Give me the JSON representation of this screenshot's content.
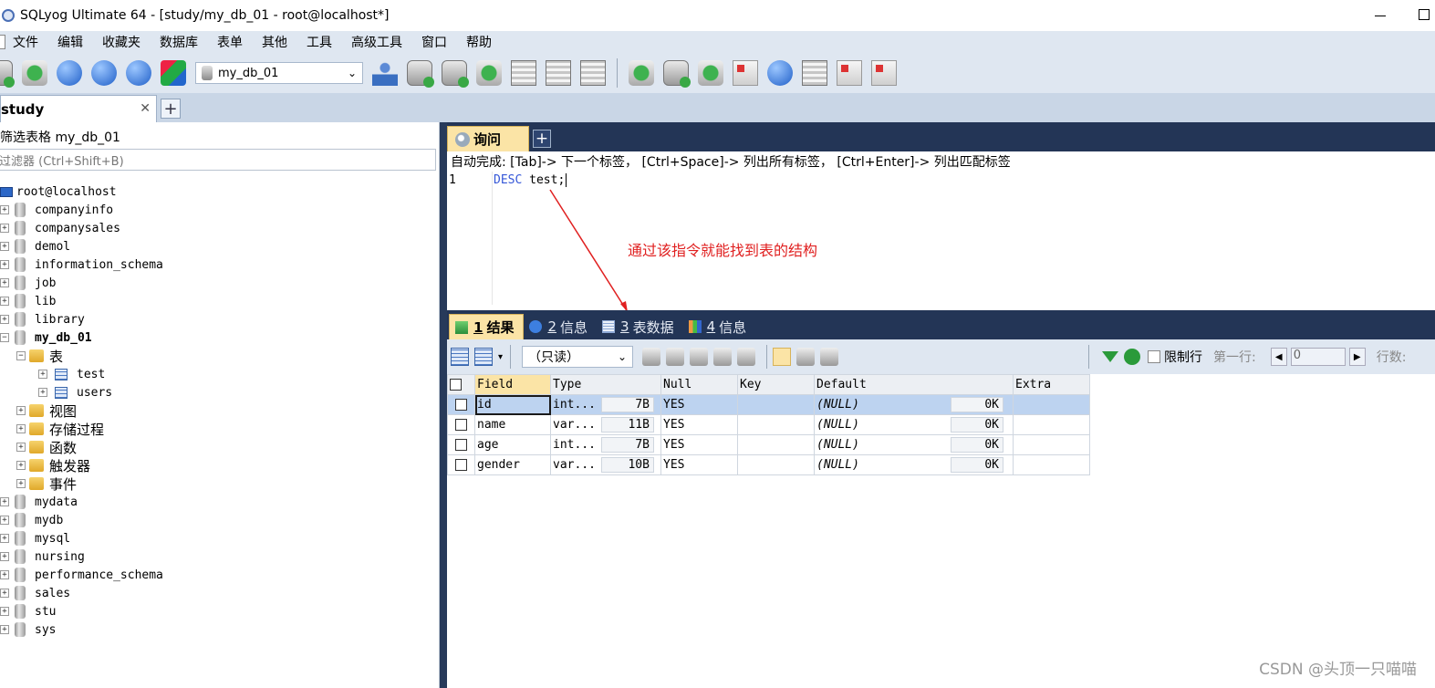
{
  "window": {
    "title": "SQLyog Ultimate 64 - [study/my_db_01 - root@localhost*]"
  },
  "menu": [
    "文件",
    "编辑",
    "收藏夹",
    "数据库",
    "表单",
    "其他",
    "工具",
    "高级工具",
    "窗口",
    "帮助"
  ],
  "toolbar": {
    "db_selector_value": "my_db_01"
  },
  "connection_tab": {
    "label": "study",
    "close_glyph": "✕",
    "add_glyph": "+"
  },
  "object_browser": {
    "filter_label": "筛选表格 my_db_01",
    "filter_placeholder": "过滤器 (Ctrl+Shift+B)",
    "server": "root@localhost",
    "databases_before": [
      "companyinfo",
      "companysales",
      "demol",
      "information_schema",
      "job",
      "lib",
      "library"
    ],
    "current_db": "my_db_01",
    "tables_folder": "表",
    "tables": [
      "test",
      "users"
    ],
    "other_folders": [
      "视图",
      "存储过程",
      "函数",
      "触发器",
      "事件"
    ],
    "databases_after": [
      "mydata",
      "mydb",
      "mysql",
      "nursing",
      "performance_schema",
      "sales",
      "stu",
      "sys"
    ]
  },
  "query": {
    "tab_label": "询问",
    "autocomplete_hint": "自动完成: [Tab]-> 下一个标签， [Ctrl+Space]-> 列出所有标签， [Ctrl+Enter]-> 列出匹配标签",
    "line_number": "1",
    "keyword": "DESC",
    "rest": " test;",
    "annotation": "通过该指令就能找到表的结构"
  },
  "result_tabs": [
    {
      "num": "1",
      "label": "结果"
    },
    {
      "num": "2",
      "label": "信息"
    },
    {
      "num": "3",
      "label": "表数据"
    },
    {
      "num": "4",
      "label": "信息"
    }
  ],
  "result_toolbar": {
    "mode": "（只读）",
    "limit_label": "限制行",
    "first_row_label": "第一行:",
    "first_row_value": "0",
    "rows_label": "行数:"
  },
  "grid": {
    "columns": [
      "Field",
      "Type",
      "Null",
      "Key",
      "Default",
      "Extra"
    ],
    "rows": [
      {
        "field": "id",
        "type": "int...",
        "type_size": "7B",
        "null": "YES",
        "key": "",
        "default": "(NULL)",
        "default_size": "0K",
        "extra": ""
      },
      {
        "field": "name",
        "type": "var...",
        "type_size": "11B",
        "null": "YES",
        "key": "",
        "default": "(NULL)",
        "default_size": "0K",
        "extra": ""
      },
      {
        "field": "age",
        "type": "int...",
        "type_size": "7B",
        "null": "YES",
        "key": "",
        "default": "(NULL)",
        "default_size": "0K",
        "extra": ""
      },
      {
        "field": "gender",
        "type": "var...",
        "type_size": "10B",
        "null": "YES",
        "key": "",
        "default": "(NULL)",
        "default_size": "0K",
        "extra": ""
      }
    ]
  },
  "watermark": "CSDN @头顶一只喵喵"
}
